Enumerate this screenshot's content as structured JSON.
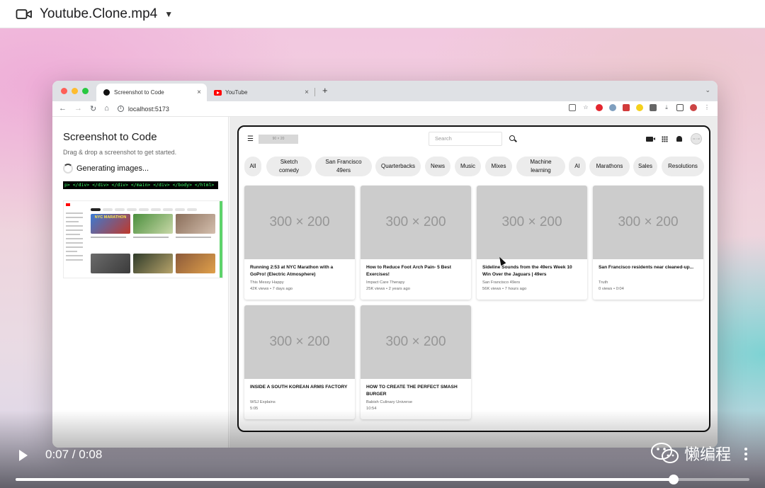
{
  "file": {
    "name": "Youtube.Clone.mp4"
  },
  "browser": {
    "tabs": [
      {
        "label": "Screenshot to Code",
        "active": true
      },
      {
        "label": "YouTube",
        "active": false
      }
    ],
    "url": "localhost:5173"
  },
  "left_panel": {
    "title": "Screenshot to Code",
    "subtitle": "Drag & drop a screenshot to get started.",
    "status": "Generating images...",
    "code_line": "p> </div> </div> </div> </main> </div> </body> </html>",
    "thumb_title": "NYC MARATHON"
  },
  "youtube": {
    "logo_placeholder": "90 × 20",
    "search_placeholder": "Search",
    "avatar_placeholder": "32 × 32",
    "chips": [
      "All",
      "Sketch comedy",
      "San Francisco 49ers",
      "Quarterbacks",
      "News",
      "Music",
      "Mixes",
      "Machine learning",
      "AI",
      "Marathons",
      "Sales",
      "Resolutions"
    ],
    "videos": [
      {
        "thumb": "300 × 200",
        "title": "Running 2:53 at NYC Marathon with a GoPro! (Electric Atmosphere)",
        "channel": "This Messy Happy",
        "meta": "42K views • 7 days ago"
      },
      {
        "thumb": "300 × 200",
        "title": "How to Reduce Foot Arch Pain- 5 Best Exercises!",
        "channel": "Impact Care Therapy",
        "meta": "25K views • 2 years ago"
      },
      {
        "thumb": "300 × 200",
        "title": "Sideline Sounds from the 49ers Week 10 Win Over the Jaguars | 49ers",
        "channel": "San Francisco 49ers",
        "meta": "56K views • 7 hours ago"
      },
      {
        "thumb": "300 × 200",
        "title": "San Francisco residents near cleaned-up...",
        "channel": "Truth",
        "meta": "0 views • 0:04"
      },
      {
        "thumb": "300 × 200",
        "title": "INSIDE A SOUTH KOREAN ARMS FACTORY",
        "channel": "WSJ Explains",
        "meta": "5:05"
      },
      {
        "thumb": "300 × 200",
        "title": "HOW TO CREATE THE PERFECT SMASH BURGER",
        "channel": "Babish Culinary Universe",
        "meta": "10:54"
      }
    ]
  },
  "player": {
    "time": "0:07 / 0:08",
    "progress_fraction": 0.897,
    "watermark": "懒编程"
  },
  "colors": {
    "accent_red": "#ff0000",
    "code_green": "#3cff6a"
  }
}
